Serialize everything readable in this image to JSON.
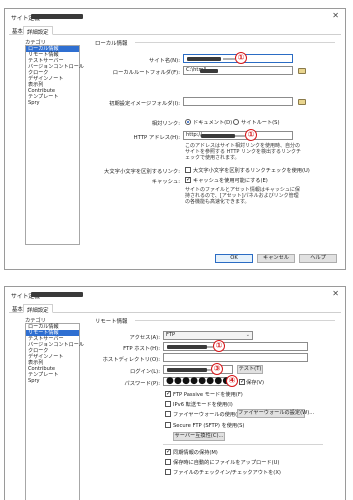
{
  "w1": {
    "title": "サイト定義",
    "tabs": [
      "基本",
      "詳細設定"
    ],
    "category_header": "カテゴリ",
    "categories": [
      "ローカル情報",
      "リモート情報",
      "テストサーバー",
      "バージョンコントロール",
      "クローク",
      "デザインノート",
      "表示列",
      "Contribute",
      "テンプレート",
      "Spry"
    ],
    "section_title": "ローカル情報",
    "site_name_label": "サイト名(N):",
    "local_root_label": "ローカルルートフォルダ(F):",
    "local_root_value": "C:\\html\\",
    "default_images_label": "初期設定イメージフォルダ(I):",
    "links_relative_label": "相対リンク:",
    "doc_radio_label": "ドキュメント(D)",
    "site_root_radio_label": "サイトルート(S)",
    "http_label": "HTTP アドレス(H):",
    "http_value": "http://",
    "http_note": "このアドレスはサイト相対リンクを使用時、自分のサイトを参照する HTTP リンクを検出するリンクチェックで使用されます。",
    "case_label": "大文字小文字を区別するリンク:",
    "case_checkbox": "大文字小文字を区別するリンクチェックを使用(U)",
    "cache_label": "キャッシュ:",
    "cache_checkbox": "キャッシュを使用可能にする(E)",
    "cache_note": "サイトのファイルとアセット情報はキャッシュに保持されるので、[アセット]パネルおよびリンク管理の各機能も高速化できます。",
    "ok_button": "OK",
    "cancel_button": "キャンセル",
    "help_button": "ヘルプ",
    "markers": [
      "①",
      "①"
    ]
  },
  "w2": {
    "title": "サイト定義",
    "tabs": [
      "基本",
      "詳細設定"
    ],
    "category_header": "カテゴリ",
    "categories": [
      "ローカル情報",
      "リモート情報",
      "テストサーバー",
      "バージョンコントロール",
      "クローク",
      "デザインノート",
      "表示列",
      "Contribute",
      "テンプレート",
      "Spry"
    ],
    "section_title": "リモート情報",
    "access_label": "アクセス(A):",
    "access_value": "FTP",
    "ftp_host_label": "FTP ホスト(H):",
    "host_dir_label": "ホストディレクトリ(O):",
    "login_label": "ログイン(L):",
    "test_button": "テスト(T)",
    "password_label": "パスワード(P):",
    "password_dots": "●●●●●●●●",
    "save_label": "保存(V)",
    "ftp_passive": "FTP Passive モードを使用(F)",
    "ipv6": "IPv6 転送モードを使用(I)",
    "firewall": "ファイヤーウォールの使用(E)",
    "firewall_button": "ファイヤーウォールの設定(W)...",
    "sftp": "Secure FTP (SFTP) を使用(S)",
    "server_compat_button": "サーバー互換性(C)...",
    "maintain_sync": "同期情報の保持(M)",
    "auto_upload": "保存時に自動的にファイルをアップロード(U)",
    "checkout": "ファイルのチェックイン/チェックアウトを(X)",
    "markers": [
      "①",
      "③",
      "④"
    ]
  }
}
